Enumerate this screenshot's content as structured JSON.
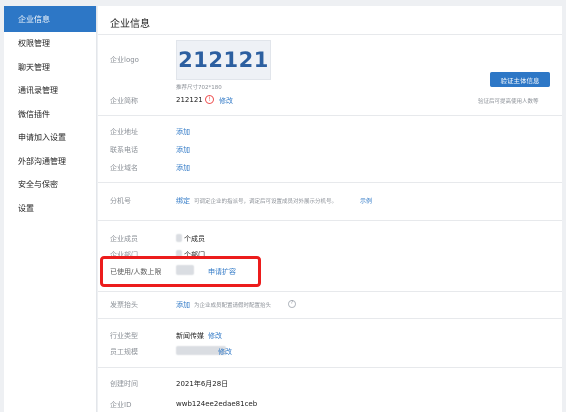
{
  "sidebar": {
    "items": [
      {
        "label": "企业信息"
      },
      {
        "label": "权限管理"
      },
      {
        "label": "聊天管理"
      },
      {
        "label": "通讯录管理"
      },
      {
        "label": "微信插件"
      },
      {
        "label": "申请加入设置"
      },
      {
        "label": "外部沟通管理"
      },
      {
        "label": "安全与保密"
      },
      {
        "label": "设置"
      }
    ]
  },
  "main": {
    "title": "企业信息",
    "logo": {
      "label": "企业logo",
      "text": "212121",
      "size_hint": "推荐尺寸702*180",
      "verify_button": "验证主体信息",
      "verify_hint": "验证后可提高使用人数等"
    },
    "company_short": {
      "label": "企业简称",
      "value": "212121",
      "action": "修改",
      "warn_icon": "!"
    },
    "address": {
      "label": "企业地址",
      "action": "添加"
    },
    "phone": {
      "label": "联系电话",
      "action": "添加"
    },
    "domain": {
      "label": "企业域名",
      "action": "添加"
    },
    "extension": {
      "label": "分机号",
      "action": "绑定",
      "hint": "可调定企业的指派号，调定后可设置成员对外展示分机号。",
      "example": "示例"
    },
    "members": {
      "label": "企业成员",
      "value": "个成员"
    },
    "departments": {
      "label": "企业部门",
      "value": "个部门"
    },
    "usage": {
      "label": "已使用/人数上限",
      "action": "申请扩容"
    },
    "invoice": {
      "label": "发票抬头",
      "action": "添加",
      "hint": "为企业成员配置请假时配置抬头"
    },
    "industry": {
      "label": "行业类型",
      "value": "新闻传媒",
      "action": "修改"
    },
    "staff_size": {
      "label": "员工规模",
      "action": "修改"
    },
    "created": {
      "label": "创建时间",
      "value": "2021年6月28日"
    },
    "corp_id": {
      "label": "企业ID",
      "value": "wwb124ee2edae81ceb"
    }
  },
  "colors": {
    "accent": "#2d77c6",
    "highlight_border": "#ec1c1c"
  }
}
